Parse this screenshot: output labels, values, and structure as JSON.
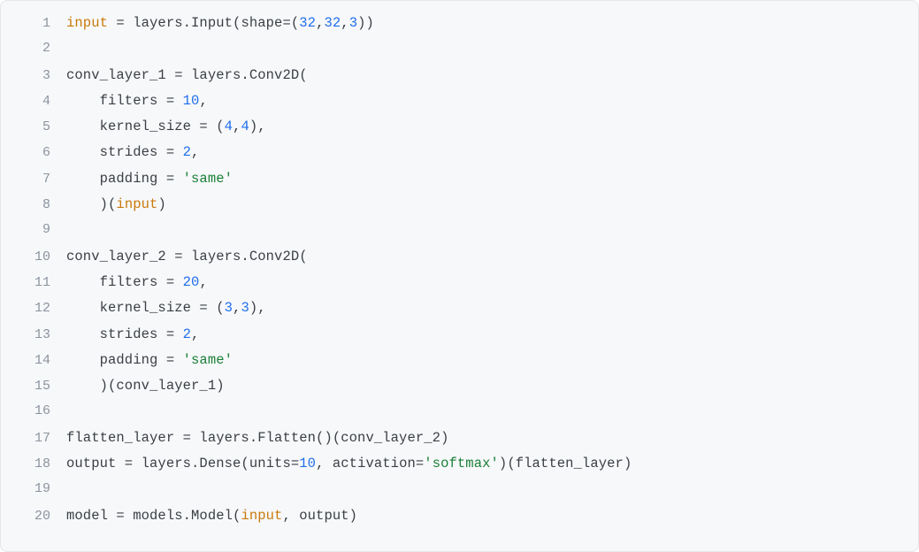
{
  "code_lines": [
    {
      "n": 1,
      "segments": [
        {
          "t": "input",
          "c": "tok-var"
        },
        {
          "t": " = layers.Input(shape=(",
          "c": "tok-op"
        },
        {
          "t": "32",
          "c": "tok-num"
        },
        {
          "t": ",",
          "c": "tok-op"
        },
        {
          "t": "32",
          "c": "tok-num"
        },
        {
          "t": ",",
          "c": "tok-op"
        },
        {
          "t": "3",
          "c": "tok-num"
        },
        {
          "t": "))",
          "c": "tok-op"
        }
      ]
    },
    {
      "n": 2,
      "segments": []
    },
    {
      "n": 3,
      "segments": [
        {
          "t": "conv_layer_1 = layers.Conv2D(",
          "c": "tok-op"
        }
      ]
    },
    {
      "n": 4,
      "segments": [
        {
          "t": "    filters = ",
          "c": "tok-op"
        },
        {
          "t": "10",
          "c": "tok-num"
        },
        {
          "t": ",",
          "c": "tok-op"
        }
      ]
    },
    {
      "n": 5,
      "segments": [
        {
          "t": "    kernel_size = (",
          "c": "tok-op"
        },
        {
          "t": "4",
          "c": "tok-num"
        },
        {
          "t": ",",
          "c": "tok-op"
        },
        {
          "t": "4",
          "c": "tok-num"
        },
        {
          "t": "),",
          "c": "tok-op"
        }
      ]
    },
    {
      "n": 6,
      "segments": [
        {
          "t": "    strides = ",
          "c": "tok-op"
        },
        {
          "t": "2",
          "c": "tok-num"
        },
        {
          "t": ",",
          "c": "tok-op"
        }
      ]
    },
    {
      "n": 7,
      "segments": [
        {
          "t": "    padding = ",
          "c": "tok-op"
        },
        {
          "t": "'same'",
          "c": "tok-str"
        }
      ]
    },
    {
      "n": 8,
      "segments": [
        {
          "t": "    )(",
          "c": "tok-op"
        },
        {
          "t": "input",
          "c": "tok-var"
        },
        {
          "t": ")",
          "c": "tok-op"
        }
      ]
    },
    {
      "n": 9,
      "segments": []
    },
    {
      "n": 10,
      "segments": [
        {
          "t": "conv_layer_2 = layers.Conv2D(",
          "c": "tok-op"
        }
      ]
    },
    {
      "n": 11,
      "segments": [
        {
          "t": "    filters = ",
          "c": "tok-op"
        },
        {
          "t": "20",
          "c": "tok-num"
        },
        {
          "t": ",",
          "c": "tok-op"
        }
      ]
    },
    {
      "n": 12,
      "segments": [
        {
          "t": "    kernel_size = (",
          "c": "tok-op"
        },
        {
          "t": "3",
          "c": "tok-num"
        },
        {
          "t": ",",
          "c": "tok-op"
        },
        {
          "t": "3",
          "c": "tok-num"
        },
        {
          "t": "),",
          "c": "tok-op"
        }
      ]
    },
    {
      "n": 13,
      "segments": [
        {
          "t": "    strides = ",
          "c": "tok-op"
        },
        {
          "t": "2",
          "c": "tok-num"
        },
        {
          "t": ",",
          "c": "tok-op"
        }
      ]
    },
    {
      "n": 14,
      "segments": [
        {
          "t": "    padding = ",
          "c": "tok-op"
        },
        {
          "t": "'same'",
          "c": "tok-str"
        }
      ]
    },
    {
      "n": 15,
      "segments": [
        {
          "t": "    )(conv_layer_1)",
          "c": "tok-op"
        }
      ]
    },
    {
      "n": 16,
      "segments": []
    },
    {
      "n": 17,
      "segments": [
        {
          "t": "flatten_layer = layers.Flatten()(conv_layer_2)",
          "c": "tok-op"
        }
      ]
    },
    {
      "n": 18,
      "segments": [
        {
          "t": "output = layers.Dense(units=",
          "c": "tok-op"
        },
        {
          "t": "10",
          "c": "tok-num"
        },
        {
          "t": ", activation=",
          "c": "tok-op"
        },
        {
          "t": "'softmax'",
          "c": "tok-str"
        },
        {
          "t": ")(flatten_layer)",
          "c": "tok-op"
        }
      ]
    },
    {
      "n": 19,
      "segments": []
    },
    {
      "n": 20,
      "segments": [
        {
          "t": "model = models.Model(",
          "c": "tok-op"
        },
        {
          "t": "input",
          "c": "tok-var"
        },
        {
          "t": ", output)",
          "c": "tok-op"
        }
      ]
    }
  ]
}
